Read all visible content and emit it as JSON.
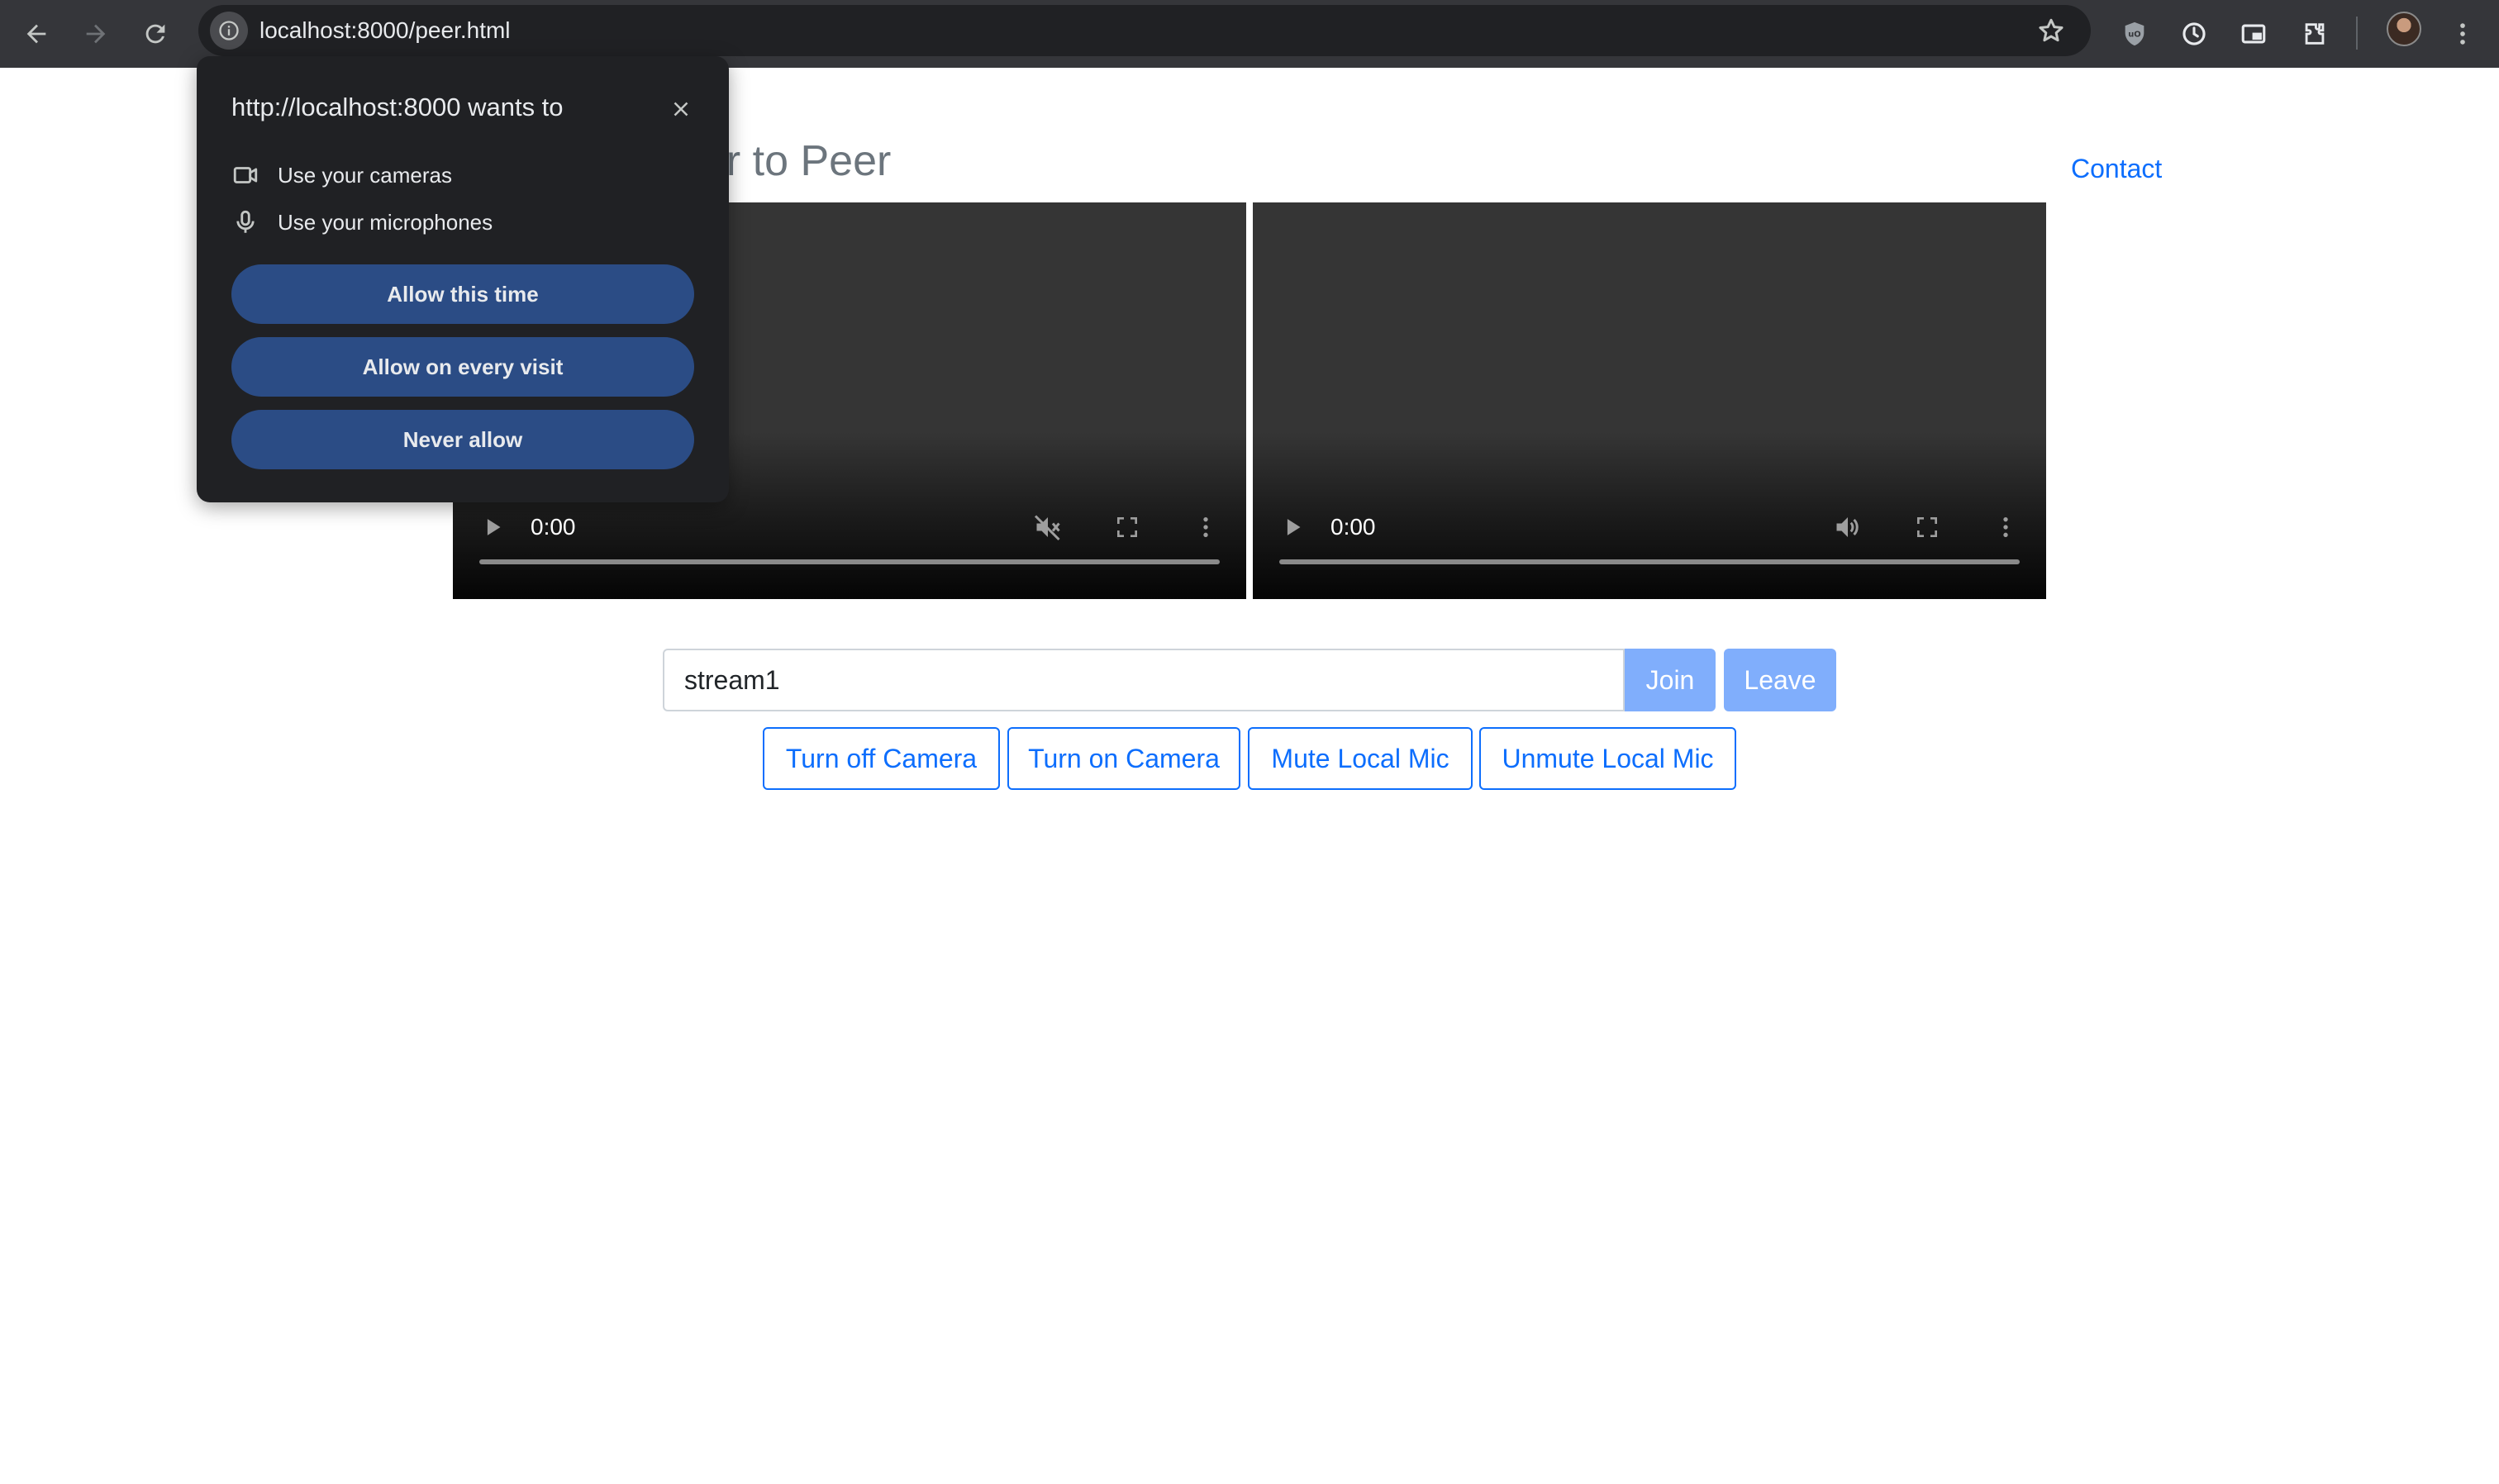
{
  "browser": {
    "url": "localhost:8000/peer.html"
  },
  "page": {
    "title": "WebRTC Peer to Peer",
    "contact_link": "Contact"
  },
  "videos": [
    {
      "time": "0:00",
      "muted": true
    },
    {
      "time": "0:00",
      "muted": false
    }
  ],
  "controls": {
    "stream_input_value": "stream1",
    "join_label": "Join",
    "leave_label": "Leave",
    "turn_off_camera": "Turn off Camera",
    "turn_on_camera": "Turn on Camera",
    "mute_mic": "Mute Local Mic",
    "unmute_mic": "Unmute Local Mic"
  },
  "permission_popup": {
    "title": "http://localhost:8000 wants to",
    "cameras": "Use your cameras",
    "microphones": "Use your microphones",
    "allow_once": "Allow this time",
    "allow_always": "Allow on every visit",
    "never": "Never allow"
  },
  "colors": {
    "chrome_bg": "#35363a",
    "link": "#0d6efd",
    "disabled_primary": "#80aefc",
    "popup_bg": "#202124",
    "popup_button": "#2b4c85"
  }
}
